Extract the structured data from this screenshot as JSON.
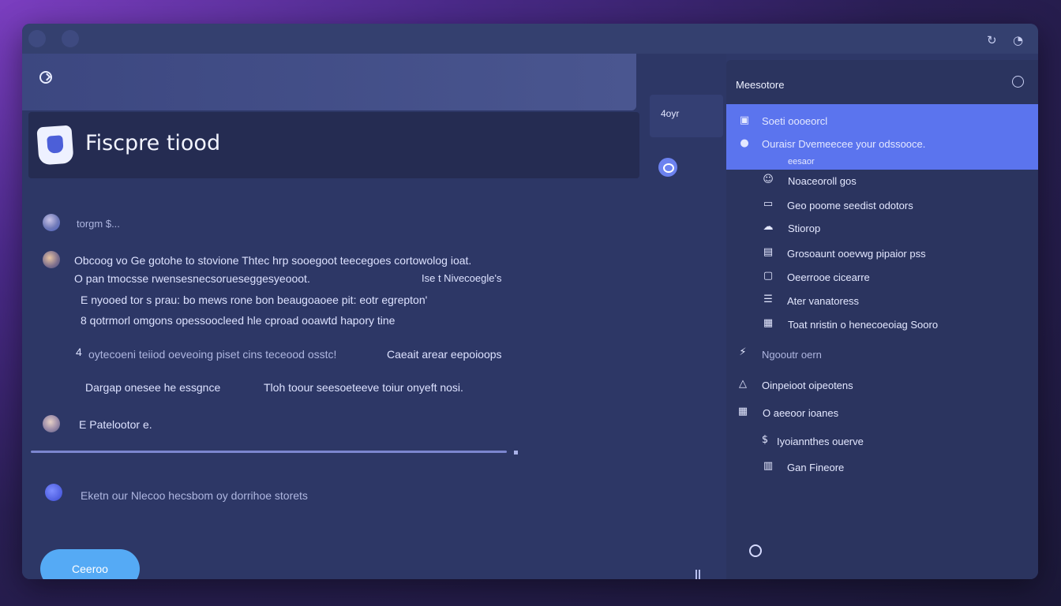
{
  "titlebar": {
    "icons": [
      "back-icon",
      "profile-icon",
      "refresh-icon",
      "clock-icon"
    ]
  },
  "main": {
    "topbar_icon": "clock-icon",
    "header": {
      "title": "Fiscpre tiood",
      "logo": "shield-logo"
    },
    "messages": [
      {
        "author": "torgm $...",
        "lines": []
      },
      {
        "lines": [
          "Obcoog vo Ge gotohe to stovione  Thtec hrp sooegoot teecegoes cortowolog ioat.",
          "O pan tmocsse rwensesnecsorueseggesyeooot.",
          "Ise t Nivecoegle's",
          "E nyooed tor s prau: bo mews rone bon beaugoaoee pit: eotr egrepton'",
          "8 qotrmorl omgons opessoocleed hle cproad ooawtd hapory tine",
          "4",
          "oytecoeni teiiod oeveoing piset  cins teceood osstc!",
          "Caeait arear eepoioops",
          "Dargap onesee he essgnce",
          "Tloh toour seesoeteeve toiur onyeft nosi."
        ]
      },
      {
        "author": "E Patelootor e."
      }
    ],
    "progress": 0.72,
    "footer_text": "Eketn our Nlecoo hecsbom oy dorrihoe storets",
    "primary_button": "Ceeroo"
  },
  "middle": {
    "tab_label": "4oyr"
  },
  "sidebar": {
    "title": "Meesotore",
    "highlight": {
      "items": [
        "Soeti oooeorcl",
        "Ouraisr Dvemeecee your odssooce.",
        "eesaor"
      ]
    },
    "items": [
      {
        "label": "Noaceoroll gos",
        "icon": "user-icon"
      },
      {
        "label": "Geo poome seedist odotors",
        "icon": "monitor-icon"
      },
      {
        "label": "Stiorop",
        "icon": "cloud-icon"
      },
      {
        "label": "Grosoaunt ooevwg pipaior pss",
        "icon": "document-icon"
      },
      {
        "label": "Oeerrooe cicearre",
        "icon": "lock-icon"
      },
      {
        "label": "Ater vanatoress",
        "icon": "list-icon"
      },
      {
        "label": "Toat nristin o henecoeoiag Sooro",
        "icon": "image-icon"
      }
    ],
    "section": {
      "label": "Ngooutr oern",
      "icon": "bolt-icon"
    },
    "group_items": [
      {
        "label": "Oinpeioot oipeotens",
        "icon": "triangle-icon"
      },
      {
        "label": "O aeeoor ioanes",
        "icon": "calendar-icon"
      },
      {
        "label": "Iyoiannthes ouerve",
        "icon": "dollar-icon"
      },
      {
        "label": "Gan Fineore",
        "icon": "grid-icon"
      }
    ],
    "bottom_icon": "settings-icon"
  }
}
